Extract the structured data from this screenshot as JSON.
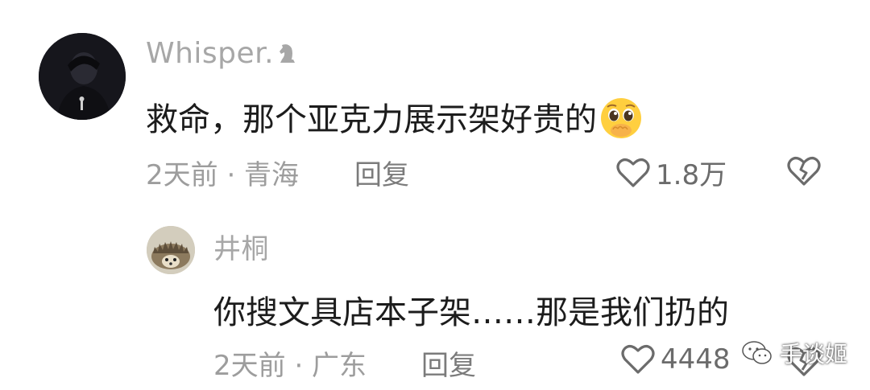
{
  "comments": [
    {
      "username": "Whisper.",
      "text": "救命，那个亚克力展示架好贵的",
      "emoji": "pleading-face-emoji",
      "meta": "2天前 · 青海",
      "reply_label": "回复",
      "likes": "1.8万"
    },
    {
      "username": "井桐",
      "text": "你搜文具店本子架……那是我们扔的",
      "meta": "2天前 · 广东",
      "reply_label": "回复",
      "likes": "4448"
    }
  ],
  "watermark": {
    "text": "手谈姬",
    "icon": "wechat-icon"
  },
  "colors": {
    "username": "#a7a7a7",
    "comment_text": "#1c1c1c",
    "meta": "#9d9d9d",
    "icon": "#6b6b6b"
  }
}
